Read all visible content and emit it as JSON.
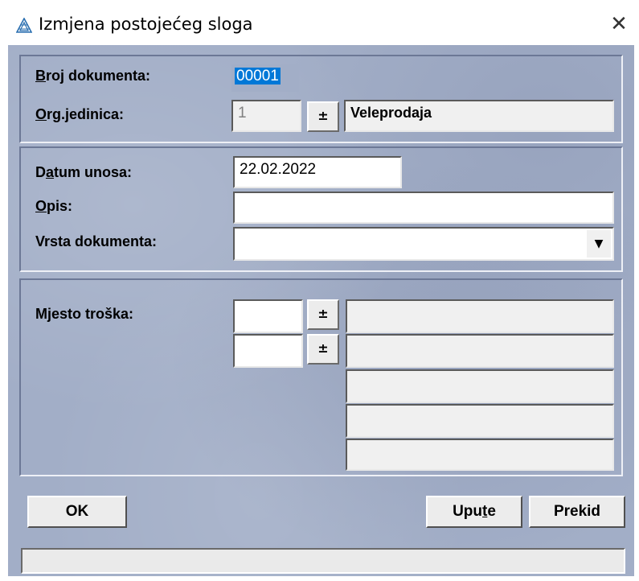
{
  "window": {
    "title": "Izmjena postojećeg sloga",
    "icon": "app-triangle-icon",
    "close_glyph": "✕"
  },
  "colors": {
    "background": "#a2aec7",
    "selection": "#0078d7"
  },
  "header": {
    "broj_label_u": "B",
    "broj_label_rest": "roj dokumenta:",
    "broj_value": "00001",
    "org_label_u": "O",
    "org_label_rest": "rg.jedinica:",
    "org_value": "1",
    "org_picker_glyph": "±",
    "org_name": "Veleprodaja"
  },
  "details": {
    "datum_label_pre": "D",
    "datum_label_u": "a",
    "datum_label_rest": "tum unosa:",
    "datum_value": "22.02.2022",
    "opis_label_u": "O",
    "opis_label_rest": "pis:",
    "opis_value": "",
    "vrsta_label": "Vrsta dokumenta:",
    "vrsta_value": "",
    "dropdown_glyph": "▼"
  },
  "cost": {
    "label": "Mjesto troška:",
    "picker_glyph": "±",
    "rows": [
      {
        "code": "",
        "name": ""
      },
      {
        "code": "",
        "name": ""
      }
    ],
    "extra_names": [
      "",
      "",
      ""
    ]
  },
  "buttons": {
    "ok": "OK",
    "upute_pre": "Upu",
    "upute_u": "t",
    "upute_rest": "e",
    "prekid": "Prekid"
  },
  "status": {
    "text": ""
  }
}
